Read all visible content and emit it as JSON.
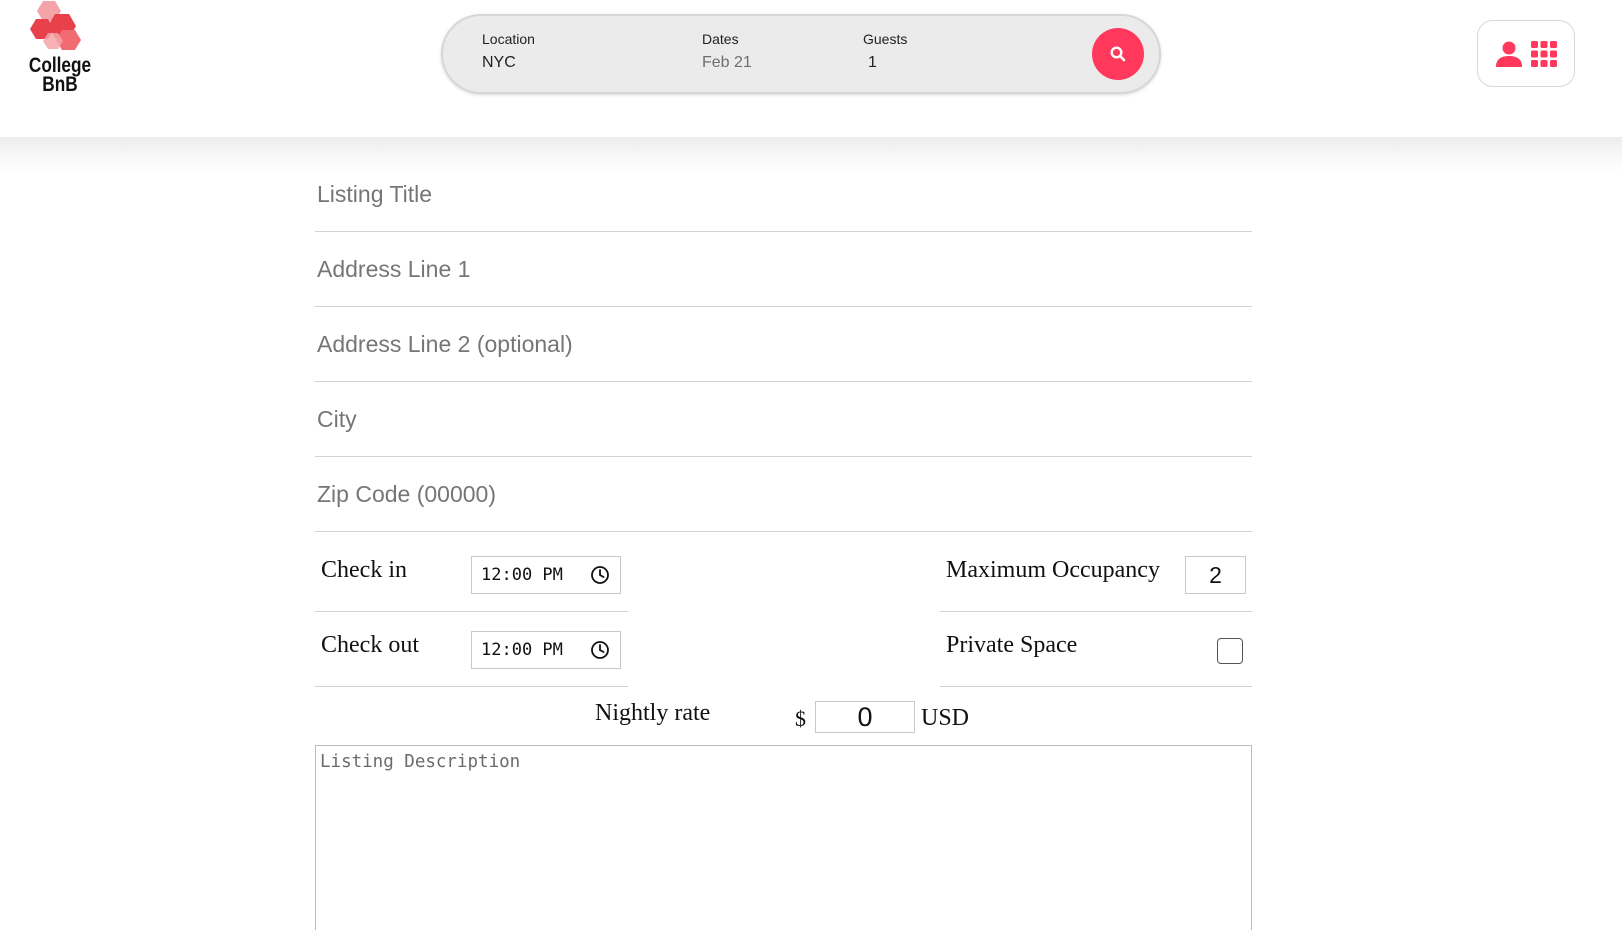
{
  "app": {
    "logo_line1": "College",
    "logo_line2": "BnB",
    "brand_color": "#ff385c",
    "logo_colors": [
      "#f4a3a8",
      "#e8414b",
      "#f26b72"
    ]
  },
  "search": {
    "location_label": "Location",
    "location_value": "NYC",
    "dates_label": "Dates",
    "dates_value": "Feb 21",
    "guests_label": "Guests",
    "guests_value": "1",
    "button_icon": "search-icon"
  },
  "user_menu": {
    "icons": [
      "user-icon",
      "grid-icon"
    ]
  },
  "form": {
    "listing_title_placeholder": "Listing Title",
    "address1_placeholder": "Address Line 1",
    "address2_placeholder": "Address Line 2 (optional)",
    "city_placeholder": "City",
    "zip_placeholder": "Zip Code (00000)",
    "check_in_label": "Check in",
    "check_in_value": "12:00 PM",
    "check_out_label": "Check out",
    "check_out_value": "12:00 PM",
    "max_occupancy_label": "Maximum Occupancy",
    "max_occupancy_value": "2",
    "private_space_label": "Private Space",
    "private_space_checked": false,
    "nightly_rate_label": "Nightly rate",
    "currency_symbol": "$",
    "nightly_rate_value": "0",
    "currency_code": "USD",
    "description_placeholder": "Listing Description"
  }
}
